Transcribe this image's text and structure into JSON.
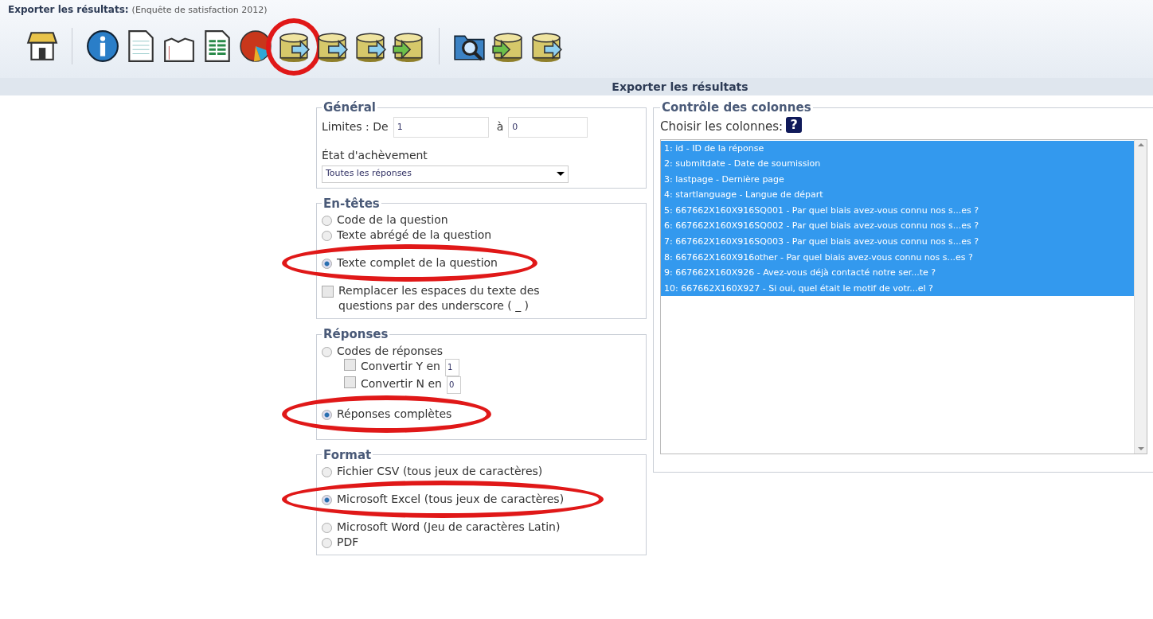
{
  "header": {
    "title": "Exporter les résultats:",
    "subtitle": "(Enquête de satisfaction 2012)"
  },
  "toolbar": [
    {
      "kind": "home",
      "circled": false
    },
    {
      "kind": "separator"
    },
    {
      "kind": "info",
      "circled": false
    },
    {
      "kind": "document",
      "circled": false
    },
    {
      "kind": "chart",
      "circled": false
    },
    {
      "kind": "report",
      "circled": false
    },
    {
      "kind": "pie",
      "circled": false
    },
    {
      "kind": "export",
      "circled": true
    },
    {
      "kind": "export-spss",
      "circled": false
    },
    {
      "kind": "export-r",
      "circled": false
    },
    {
      "kind": "import",
      "circled": false
    },
    {
      "kind": "separator"
    },
    {
      "kind": "browse",
      "circled": false
    },
    {
      "kind": "import-vv",
      "circled": false
    },
    {
      "kind": "export-vv",
      "circled": false
    }
  ],
  "panel_title": "Exporter les résultats",
  "general": {
    "legend": "Général",
    "limits_label": "Limites : De",
    "from": "1",
    "to_label": "à",
    "to": "0",
    "completion_label": "État d'achèvement",
    "completion_value": "Toutes les réponses"
  },
  "headings": {
    "legend": "En-têtes",
    "items": [
      {
        "kind": "radio",
        "label": "Code de la question",
        "selected": false,
        "circled": false
      },
      {
        "kind": "radio",
        "label": "Texte abrégé de la question",
        "selected": false,
        "circled": false
      },
      {
        "kind": "radio",
        "label": "Texte complet de la question",
        "selected": true,
        "circled": true
      },
      {
        "kind": "checkbox",
        "label": "Remplacer les espaces du texte des questions par des underscore ( _ )",
        "checked": false,
        "circled": false
      }
    ]
  },
  "responses": {
    "legend": "Réponses",
    "items": [
      {
        "kind": "radio",
        "label": "Codes de réponses",
        "selected": false,
        "circled": false
      },
      {
        "kind": "convert",
        "label": "Convertir Y en",
        "value": "1",
        "checked": false,
        "circled": false
      },
      {
        "kind": "convert",
        "label": "Convertir N en",
        "value": "0",
        "checked": false,
        "circled": false
      },
      {
        "kind": "radio",
        "label": "Réponses complètes",
        "selected": true,
        "circled": true
      }
    ]
  },
  "format": {
    "legend": "Format",
    "items": [
      {
        "kind": "radio",
        "label": "Fichier CSV (tous jeux de caractères)",
        "selected": false,
        "circled": false
      },
      {
        "kind": "radio",
        "label": "Microsoft Excel (tous jeux de caractères)",
        "selected": true,
        "circled": true
      },
      {
        "kind": "radio",
        "label": "Microsoft Word (Jeu de caractères Latin)",
        "selected": false,
        "circled": false
      },
      {
        "kind": "radio",
        "label": "PDF",
        "selected": false,
        "circled": false
      }
    ]
  },
  "columns": {
    "legend": "Contrôle des colonnes",
    "label": "Choisir les colonnes:",
    "help": "?",
    "items": [
      {
        "label": "1: id - ID de la réponse",
        "selected": true
      },
      {
        "label": "2: submitdate - Date de soumission",
        "selected": true
      },
      {
        "label": "3: lastpage - Dernière page",
        "selected": true
      },
      {
        "label": "4: startlanguage - Langue de départ",
        "selected": true
      },
      {
        "label": "5: 667662X160X916SQ001 - Par quel biais avez-vous connu nos s...es ?",
        "selected": true
      },
      {
        "label": "6: 667662X160X916SQ002 - Par quel biais avez-vous connu nos s...es ?",
        "selected": true
      },
      {
        "label": "7: 667662X160X916SQ003 - Par quel biais avez-vous connu nos s...es ?",
        "selected": true
      },
      {
        "label": "8: 667662X160X916other - Par quel biais avez-vous connu nos s...es ?",
        "selected": true
      },
      {
        "label": "9: 667662X160X926 - Avez-vous déjà contacté notre ser...te ?",
        "selected": true
      },
      {
        "label": "10: 667662X160X927 - Si oui, quel était le motif de votr...el ?",
        "selected": true
      }
    ]
  }
}
